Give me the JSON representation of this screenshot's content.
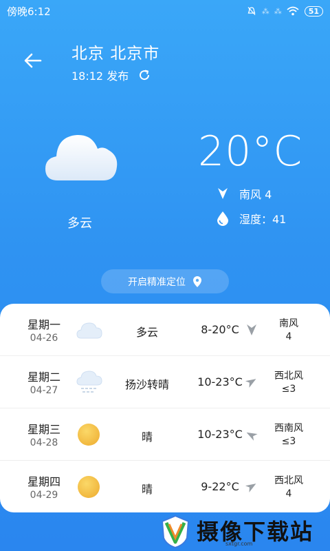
{
  "status_bar": {
    "time": "傍晚6:12",
    "signal_1": "⁂",
    "signal_2": "⁂",
    "battery": "51"
  },
  "header": {
    "city": "北京 北京市",
    "publish_time": "18:12 发布"
  },
  "current": {
    "condition": "多云",
    "temperature": "20°C",
    "wind": "南风  4",
    "humidity": "湿度：41"
  },
  "locate_button": {
    "label": "开启精准定位"
  },
  "forecast": [
    {
      "day": "星期一",
      "date": "04-26",
      "icon": "cloud-icon",
      "condition": "多云",
      "temp": "8-20°C",
      "wind_dir": "南风",
      "wind_level": "4"
    },
    {
      "day": "星期二",
      "date": "04-27",
      "icon": "dust-cloud-icon",
      "condition": "扬沙转晴",
      "temp": "10-23°C",
      "wind_dir": "西北风",
      "wind_level": "≤3"
    },
    {
      "day": "星期三",
      "date": "04-28",
      "icon": "sun-icon",
      "condition": "晴",
      "temp": "10-23°C",
      "wind_dir": "西南风",
      "wind_level": "≤3"
    },
    {
      "day": "星期四",
      "date": "04-29",
      "icon": "sun-icon",
      "condition": "晴",
      "temp": "9-22°C",
      "wind_dir": "西北风",
      "wind_level": "4"
    }
  ],
  "watermark": {
    "text": "摄像下载站",
    "url": "sxtgr.com"
  },
  "colors": {
    "background": "#2f93f2",
    "card": "#ffffff",
    "sun": "#f6c243"
  }
}
